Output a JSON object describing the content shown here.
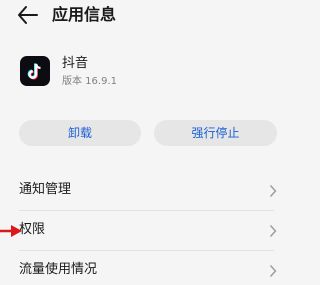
{
  "header": {
    "title": "应用信息",
    "back_icon": "back-arrow-icon"
  },
  "app": {
    "name": "抖音",
    "version": "版本 16.9.1",
    "icon": "tiktok-logo-icon",
    "icon_bg": "#0c0c12"
  },
  "actions": {
    "uninstall_label": "卸载",
    "force_stop_label": "强行停止",
    "accent_color": "#1b5fd6"
  },
  "menu": [
    {
      "label": "通知管理"
    },
    {
      "label": "权限"
    },
    {
      "label": "流量使用情况"
    }
  ],
  "annotation": {
    "icon": "red-pointer-arrow-icon",
    "color": "#d9191c"
  }
}
